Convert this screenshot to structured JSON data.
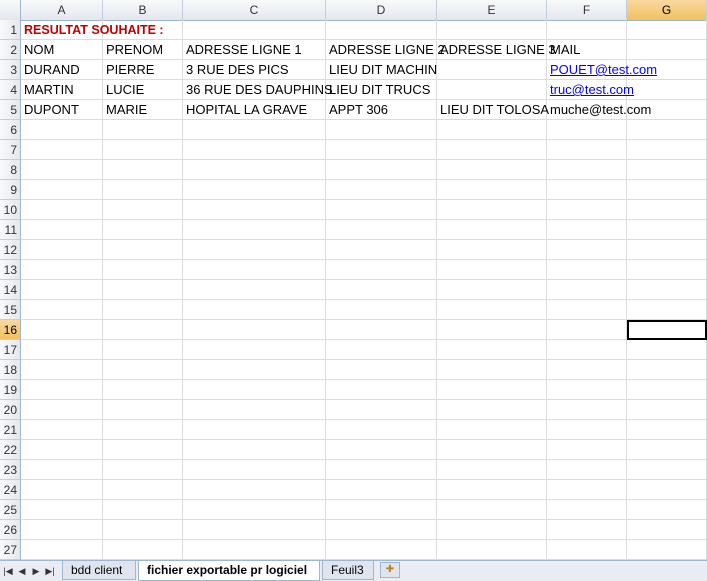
{
  "columns": [
    "A",
    "B",
    "C",
    "D",
    "E",
    "F",
    "G"
  ],
  "selected_column": "G",
  "selected_row": "16",
  "rows": [
    {
      "num": "1",
      "cells": [
        "RESULTAT SOUHAITE :",
        "",
        "",
        "",
        "",
        "",
        ""
      ]
    },
    {
      "num": "2",
      "cells": [
        "NOM",
        "PRENOM",
        "ADRESSE LIGNE 1",
        "ADRESSE LIGNE 2",
        "ADRESSE LIGNE 3",
        "MAIL",
        ""
      ]
    },
    {
      "num": "3",
      "cells": [
        "DURAND",
        "PIERRE",
        "3 RUE DES PICS",
        "LIEU DIT MACHIN",
        "",
        "POUET@test.com",
        ""
      ]
    },
    {
      "num": "4",
      "cells": [
        "MARTIN",
        "LUCIE",
        "36 RUE DES DAUPHINS",
        "LIEU DIT TRUCS",
        "",
        "truc@test.com",
        ""
      ]
    },
    {
      "num": "5",
      "cells": [
        "DUPONT",
        "MARIE",
        "HOPITAL LA GRAVE",
        "APPT 306",
        "LIEU DIT TOLOSA",
        "muche@test.com",
        ""
      ]
    },
    {
      "num": "6",
      "cells": [
        "",
        "",
        "",
        "",
        "",
        "",
        ""
      ]
    },
    {
      "num": "7",
      "cells": [
        "",
        "",
        "",
        "",
        "",
        "",
        ""
      ]
    },
    {
      "num": "8",
      "cells": [
        "",
        "",
        "",
        "",
        "",
        "",
        ""
      ]
    },
    {
      "num": "9",
      "cells": [
        "",
        "",
        "",
        "",
        "",
        "",
        ""
      ]
    },
    {
      "num": "10",
      "cells": [
        "",
        "",
        "",
        "",
        "",
        "",
        ""
      ]
    },
    {
      "num": "11",
      "cells": [
        "",
        "",
        "",
        "",
        "",
        "",
        ""
      ]
    },
    {
      "num": "12",
      "cells": [
        "",
        "",
        "",
        "",
        "",
        "",
        ""
      ]
    },
    {
      "num": "13",
      "cells": [
        "",
        "",
        "",
        "",
        "",
        "",
        ""
      ]
    },
    {
      "num": "14",
      "cells": [
        "",
        "",
        "",
        "",
        "",
        "",
        ""
      ]
    },
    {
      "num": "15",
      "cells": [
        "",
        "",
        "",
        "",
        "",
        "",
        ""
      ]
    },
    {
      "num": "16",
      "cells": [
        "",
        "",
        "",
        "",
        "",
        "",
        ""
      ]
    },
    {
      "num": "17",
      "cells": [
        "",
        "",
        "",
        "",
        "",
        "",
        ""
      ]
    },
    {
      "num": "18",
      "cells": [
        "",
        "",
        "",
        "",
        "",
        "",
        ""
      ]
    },
    {
      "num": "19",
      "cells": [
        "",
        "",
        "",
        "",
        "",
        "",
        ""
      ]
    },
    {
      "num": "20",
      "cells": [
        "",
        "",
        "",
        "",
        "",
        "",
        ""
      ]
    },
    {
      "num": "21",
      "cells": [
        "",
        "",
        "",
        "",
        "",
        "",
        ""
      ]
    },
    {
      "num": "22",
      "cells": [
        "",
        "",
        "",
        "",
        "",
        "",
        ""
      ]
    },
    {
      "num": "23",
      "cells": [
        "",
        "",
        "",
        "",
        "",
        "",
        ""
      ]
    },
    {
      "num": "24",
      "cells": [
        "",
        "",
        "",
        "",
        "",
        "",
        ""
      ]
    },
    {
      "num": "25",
      "cells": [
        "",
        "",
        "",
        "",
        "",
        "",
        ""
      ]
    },
    {
      "num": "26",
      "cells": [
        "",
        "",
        "",
        "",
        "",
        "",
        ""
      ]
    },
    {
      "num": "27",
      "cells": [
        "",
        "",
        "",
        "",
        "",
        "",
        ""
      ]
    }
  ],
  "links": [
    "POUET@test.com",
    "truc@test.com"
  ],
  "title_color": "#c00000",
  "link_color": "#0000ff",
  "sheet_tabs": [
    {
      "label": "bdd client",
      "active": false
    },
    {
      "label": "fichier exportable pr logiciel",
      "active": true
    },
    {
      "label": "Feuil3",
      "active": false
    }
  ],
  "nav_icons": [
    "first-sheet-icon",
    "prev-sheet-icon",
    "next-sheet-icon",
    "last-sheet-icon"
  ],
  "nav_glyphs": [
    "|◀",
    "◀",
    "▶",
    "▶|"
  ],
  "add_sheet_icon": "insert-sheet-icon"
}
